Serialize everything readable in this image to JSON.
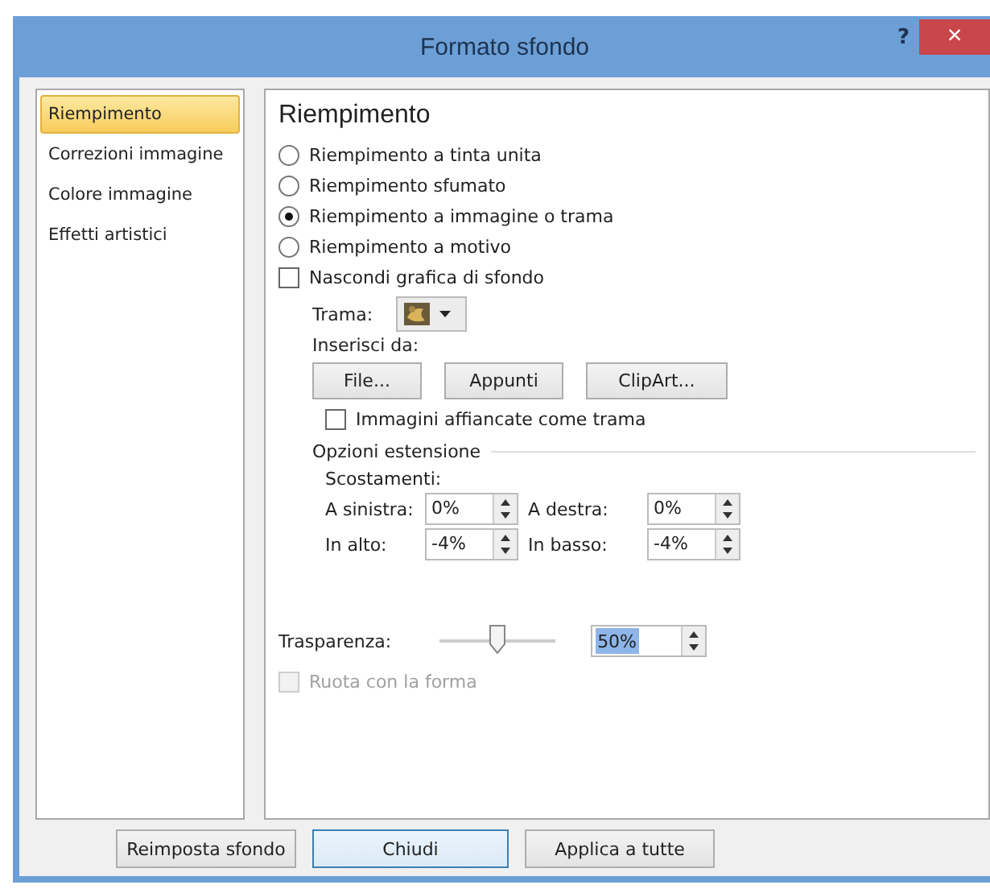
{
  "window": {
    "title": "Formato sfondo",
    "help": "?",
    "close": "×"
  },
  "sidebar": {
    "items": [
      {
        "label": "Riempimento",
        "selected": true
      },
      {
        "label": "Correzioni immagine",
        "selected": false
      },
      {
        "label": "Colore immagine",
        "selected": false
      },
      {
        "label": "Effetti artistici",
        "selected": false
      }
    ]
  },
  "panel": {
    "heading": "Riempimento",
    "fill_options": [
      {
        "label": "Riempimento a tinta unita",
        "selected": false
      },
      {
        "label": "Riempimento sfumato",
        "selected": false
      },
      {
        "label": "Riempimento a immagine o trama",
        "selected": true
      },
      {
        "label": "Riempimento a motivo",
        "selected": false
      }
    ],
    "hide_background": {
      "label": "Nascondi grafica di sfondo",
      "checked": false
    },
    "texture": {
      "label": "Trama:"
    },
    "insert_from": {
      "label": "Inserisci da:",
      "buttons": [
        "File...",
        "Appunti",
        "ClipArt..."
      ]
    },
    "tile": {
      "label": "Immagini affiancate come trama",
      "checked": false
    },
    "stretch": {
      "title": "Opzioni estensione",
      "offsets_label": "Scostamenti:",
      "offsets": [
        {
          "label": "A sinistra:",
          "value": "0%"
        },
        {
          "label": "A destra:",
          "value": "0%"
        },
        {
          "label": "In alto:",
          "value": "-4%"
        },
        {
          "label": "In basso:",
          "value": "-4%"
        }
      ]
    },
    "transparency": {
      "label": "Trasparenza:",
      "level": 0.5,
      "value": "50%"
    },
    "rotate": {
      "label": "Ruota con la forma",
      "checked": false,
      "disabled": true
    }
  },
  "buttons": [
    "Reimposta sfondo",
    "Chiudi",
    "Applica a tutte"
  ]
}
